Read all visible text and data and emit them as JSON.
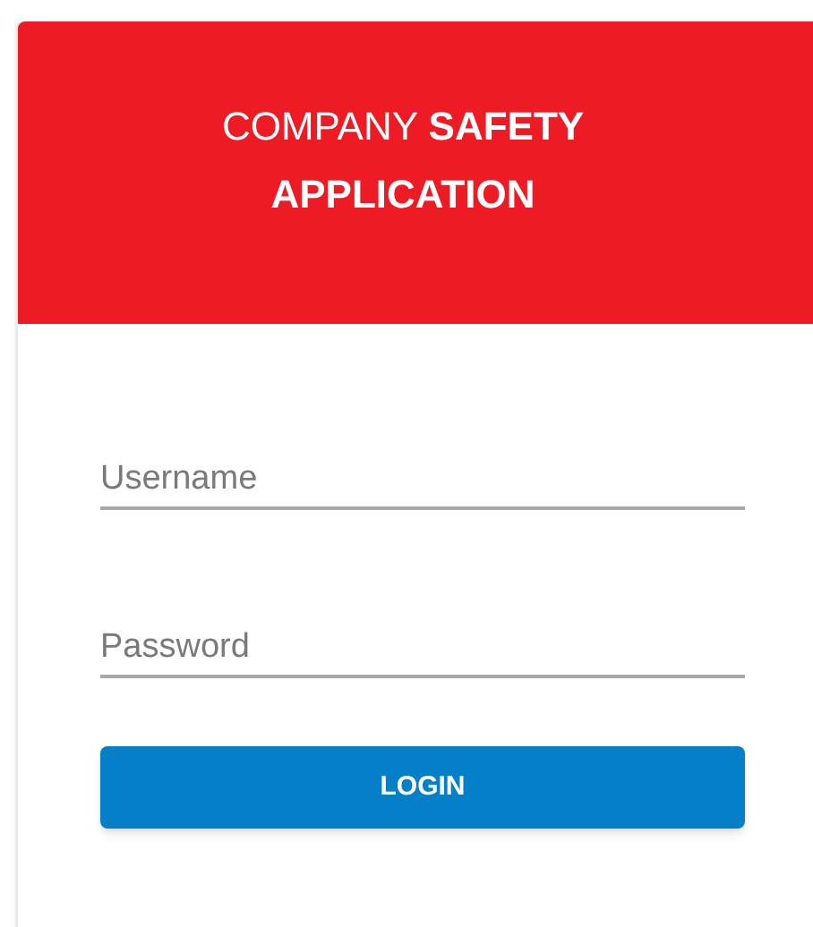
{
  "header": {
    "title": "COMPANY **SAFETY APPLICATION**"
  },
  "fields": [
    {
      "placeholder": "Username"
    },
    {
      "placeholder": "Password"
    }
  ],
  "button": {
    "label": "LOGIN"
  }
}
